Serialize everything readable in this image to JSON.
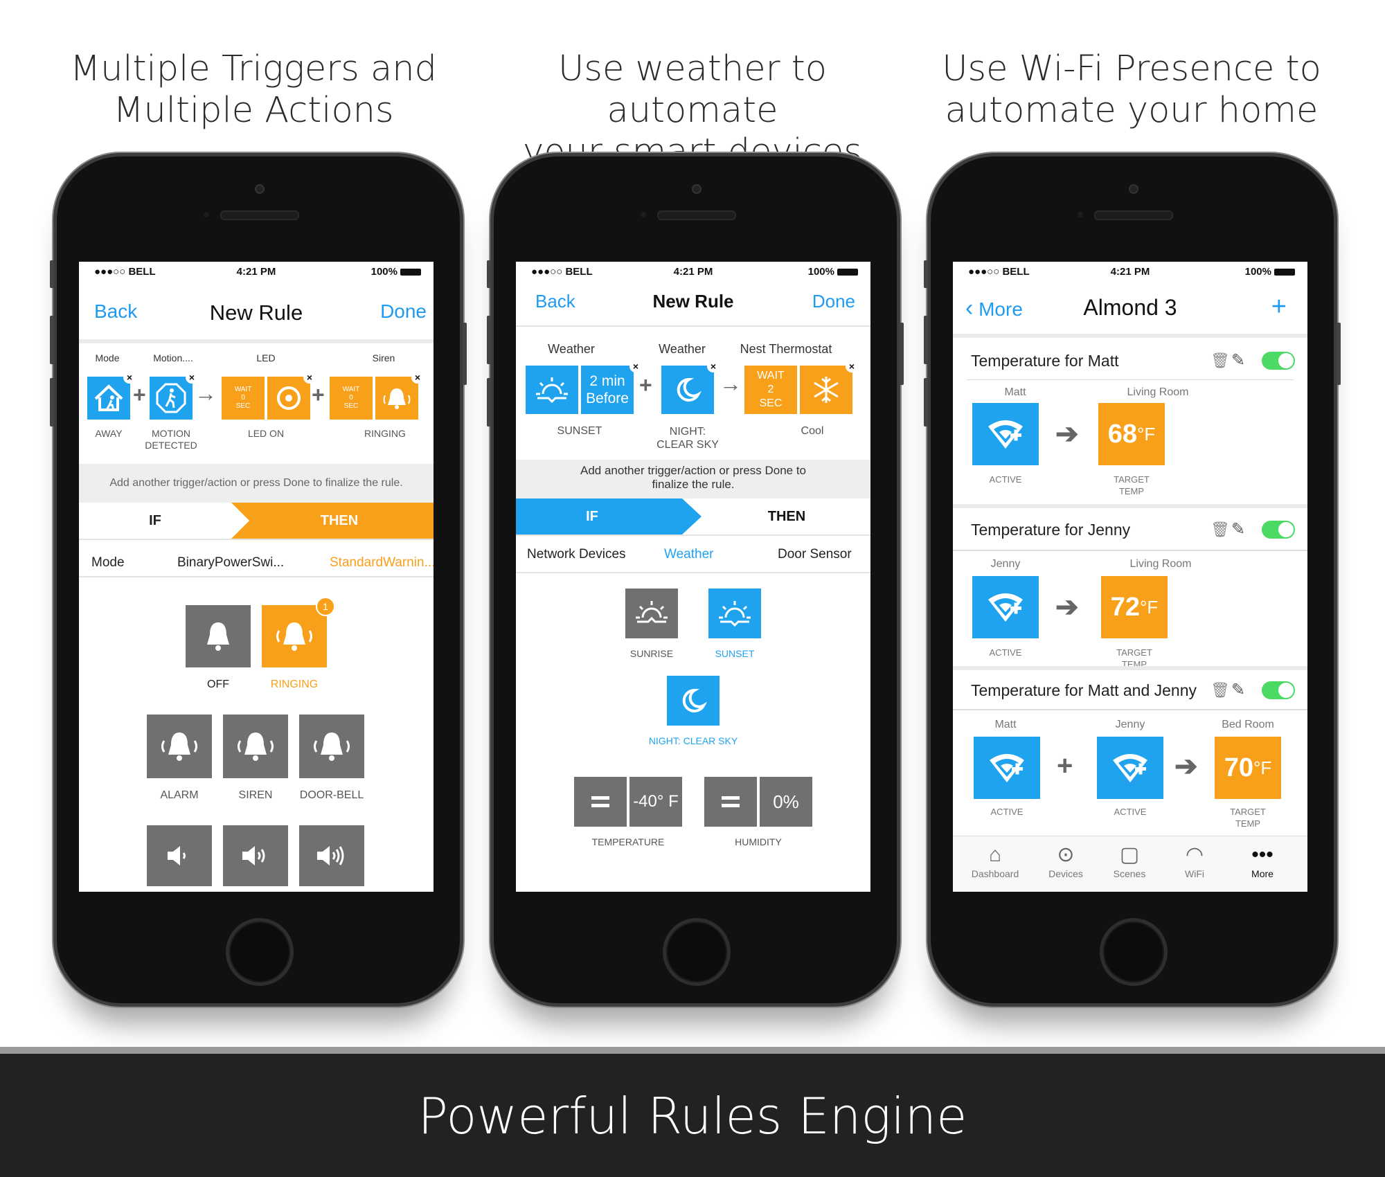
{
  "captions": [
    "Multiple Triggers and\nMultiple Actions",
    "Use weather to automate\nyour smart devices",
    "Use Wi-Fi Presence to\nautomate your home"
  ],
  "footer": "Powerful Rules Engine",
  "status": {
    "carrier": "●●●○○ BELL",
    "time": "4:21 PM",
    "battery": "100%"
  },
  "phone1": {
    "nav": {
      "back": "Back",
      "title": "New Rule",
      "done": "Done"
    },
    "chain_headers": [
      "Mode",
      "Motion....",
      "LED",
      "Siren"
    ],
    "chain_labels": [
      "AWAY",
      "MOTION\nDETECTED",
      "LED ON",
      "RINGING"
    ],
    "wait_text": "WAIT\n0\nSEC",
    "hint": "Add another trigger/action or press Done to finalize the rule.",
    "if_label": "IF",
    "then_label": "THEN",
    "categories": [
      "Mode",
      "BinaryPowerSwi...",
      "StandardWarnin..."
    ],
    "state_labels": [
      "OFF",
      "RINGING"
    ],
    "badge": "1",
    "sound_labels": [
      "ALARM",
      "SIREN",
      "DOOR-BELL"
    ]
  },
  "phone2": {
    "nav": {
      "back": "Back",
      "title": "New Rule",
      "done": "Done"
    },
    "chain_headers": [
      "Weather",
      "Weather",
      "Nest Thermostat"
    ],
    "offset_text": "2 min\nBefore",
    "wait_text": "WAIT\n2\nSEC",
    "chain_labels": [
      "SUNSET",
      "NIGHT:\nCLEAR SKY",
      "Cool"
    ],
    "hint": "Add another trigger/action or press Done to\nfinalize the rule.",
    "if_label": "IF",
    "then_label": "THEN",
    "categories": [
      "Network Devices",
      "Weather",
      "Door Sensor"
    ],
    "weather_labels": [
      "SUNRISE",
      "SUNSET",
      "NIGHT: CLEAR SKY"
    ],
    "temperature_value": "-40° F",
    "humidity_value": "0%",
    "condition_labels": [
      "TEMPERATURE",
      "HUMIDITY"
    ]
  },
  "phone3": {
    "nav": {
      "back": "More",
      "title": "Almond 3",
      "plus": "+"
    },
    "rules": [
      {
        "title": "Temperature for Matt",
        "cols": [
          "Matt",
          "Living Room"
        ],
        "labels": [
          "ACTIVE",
          "TARGET\nTEMP"
        ],
        "temp": "68",
        "unit": "°F"
      },
      {
        "title": "Temperature for Jenny",
        "cols": [
          "Jenny",
          "Living Room"
        ],
        "labels": [
          "ACTIVE",
          "TARGET\nTEMP"
        ],
        "temp": "72",
        "unit": "°F"
      },
      {
        "title": "Temperature for Matt and Jenny",
        "cols": [
          "Matt",
          "Jenny",
          "Bed Room"
        ],
        "labels": [
          "ACTIVE",
          "ACTIVE",
          "TARGET\nTEMP"
        ],
        "temp": "70",
        "unit": "°F"
      }
    ],
    "tabbar": [
      "Dashboard",
      "Devices",
      "Scenes",
      "WiFi",
      "More"
    ]
  },
  "colors": {
    "blue": "#1fa3ef",
    "orange": "#f9a01b",
    "gray": "#707070",
    "toggle": "#4cd964"
  },
  "icons": [
    "home-person-icon",
    "motion-icon",
    "led-icon",
    "bell-icon",
    "ringing-bell-icon",
    "sun-icon",
    "moon-icon",
    "snowflake-icon",
    "speaker-icon",
    "wifi-plus-icon",
    "arrow-right-icon",
    "trash-icon",
    "pencil-icon",
    "chevron-left-icon",
    "dashboard-icon",
    "devices-icon",
    "scenes-icon",
    "wifi-icon",
    "more-icon"
  ]
}
